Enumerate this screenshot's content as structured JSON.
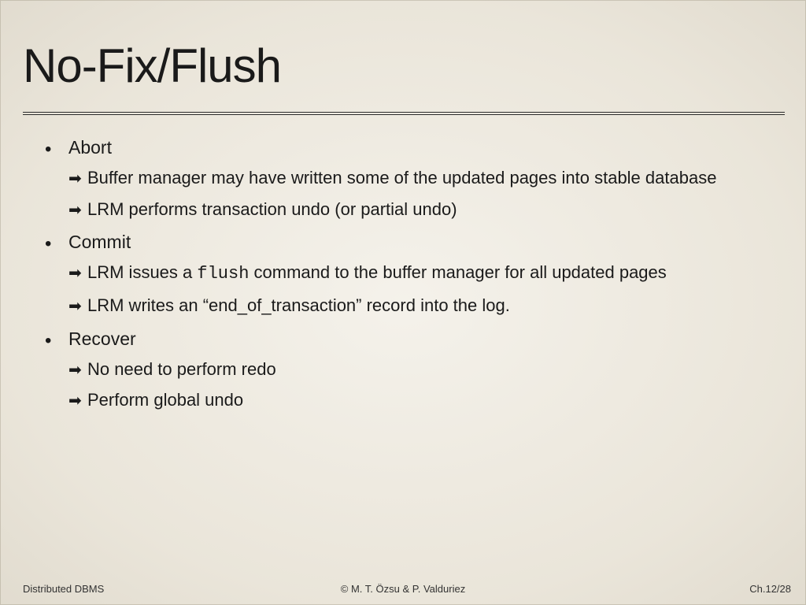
{
  "title": "No-Fix/Flush",
  "bullets": {
    "b1": {
      "label": "Abort",
      "s1": "Buffer manager may have written some of the updated pages into stable database",
      "s2": "LRM  performs transaction undo (or partial undo)"
    },
    "b2": {
      "label": "Commit",
      "s1_pre": "LRM issues a ",
      "s1_code": "flush",
      "s1_post": " command to the buffer manager for all updated pages",
      "s2": "LRM writes an “end_of_transaction” record into the log."
    },
    "b3": {
      "label": "Recover",
      "s1": "No need to perform  redo",
      "s2": "Perform global undo"
    }
  },
  "footer": {
    "left": "Distributed DBMS",
    "center": "© M. T. Özsu & P. Valduriez",
    "right": "Ch.12/28"
  }
}
